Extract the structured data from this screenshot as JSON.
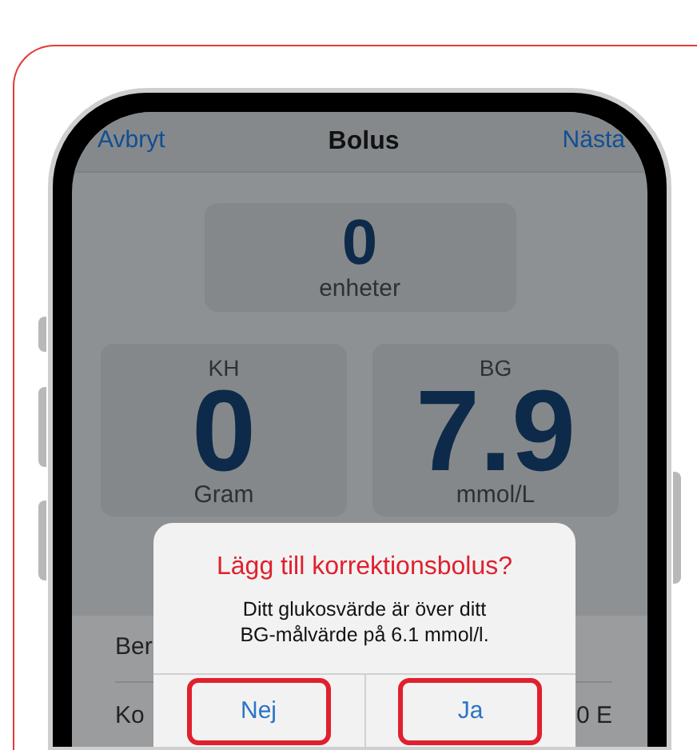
{
  "nav": {
    "cancel": "Avbryt",
    "title": "Bolus",
    "next": "Nästa"
  },
  "total": {
    "value": "0",
    "unit": "enheter"
  },
  "inputs": [
    {
      "label": "KH",
      "value": "0",
      "unit": "Gram"
    },
    {
      "label": "BG",
      "value": "7.9",
      "unit": "mmol/L"
    }
  ],
  "rows": [
    {
      "label": "Ber"
    },
    {
      "label": "Ko",
      "value": "0 E"
    }
  ],
  "alert": {
    "title": "Lägg till korrektionsbolus?",
    "message": "Ditt glukosvärde är över ditt BG-målvärde på 6.1 mmol/l.",
    "buttons": [
      {
        "label": "Nej",
        "highlighted": true
      },
      {
        "label": "Ja",
        "highlighted": true
      }
    ]
  }
}
